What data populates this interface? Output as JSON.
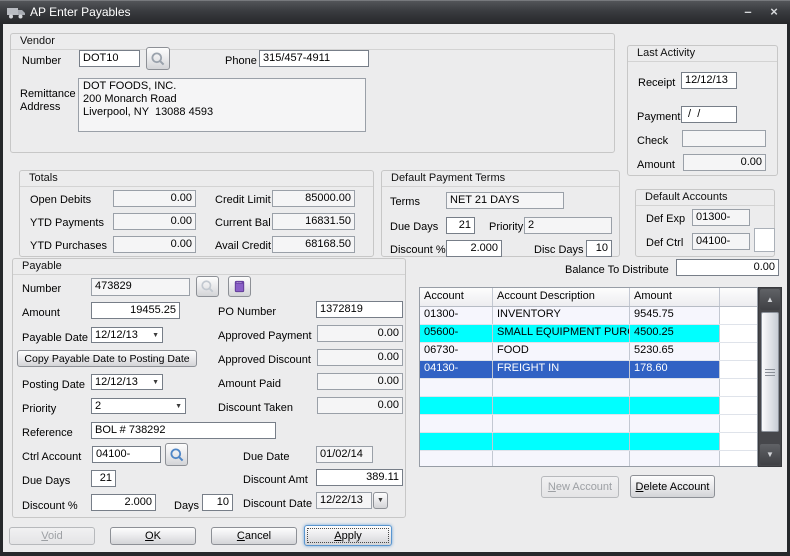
{
  "window": {
    "title": "AP Enter Payables"
  },
  "glyphs": {
    "minimize": "–",
    "close": "×",
    "arrow_down": "▼",
    "arrow_up": "▲"
  },
  "vendor": {
    "caption": "Vendor",
    "number_label": "Number",
    "number": "DOT10",
    "phone_label": "Phone",
    "phone": "315/457-4911",
    "remittance_label": "Remittance\nAddress",
    "address": "DOT FOODS, INC.\n200 Monarch Road\nLiverpool, NY  13088 4593"
  },
  "last_activity": {
    "caption": "Last Activity",
    "receipt_label": "Receipt",
    "receipt": "12/12/13",
    "payment_label": "Payment",
    "payment": " /  /",
    "check_label": "Check",
    "check": "",
    "amount_label": "Amount",
    "amount": "0.00"
  },
  "totals": {
    "caption": "Totals",
    "open_debits_label": "Open Debits",
    "open_debits": "0.00",
    "ytd_payments_label": "YTD Payments",
    "ytd_payments": "0.00",
    "ytd_purchases_label": "YTD Purchases",
    "ytd_purchases": "0.00",
    "credit_limit_label": "Credit Limit",
    "credit_limit": "85000.00",
    "current_bal_label": "Current Bal",
    "current_bal": "16831.50",
    "avail_credit_label": "Avail Credit",
    "avail_credit": "68168.50"
  },
  "terms": {
    "caption": "Default Payment Terms",
    "terms_label": "Terms",
    "terms": "NET 21 DAYS",
    "due_days_label": "Due Days",
    "due_days": "21",
    "priority_label": "Priority",
    "priority": "2",
    "discount_label": "Discount %",
    "discount": "2.000",
    "disc_days_label": "Disc Days",
    "disc_days": "10"
  },
  "default_accounts": {
    "caption": "Default Accounts",
    "def_exp_label": "Def Exp",
    "def_exp": "01300-",
    "def_ctrl_label": "Def Ctrl",
    "def_ctrl": "04100-"
  },
  "payable": {
    "caption": "Payable",
    "number_label": "Number",
    "number": "473829",
    "amount_label": "Amount",
    "amount": "19455.25",
    "payable_date_label": "Payable Date",
    "payable_date": "12/12/13",
    "copy_button": "Copy Payable Date to Posting Date",
    "posting_date_label": "Posting Date",
    "posting_date": "12/12/13",
    "priority_label": "Priority",
    "priority": "2",
    "reference_label": "Reference",
    "reference": "BOL # 738292",
    "ctrl_account_label": "Ctrl Account",
    "ctrl_account": "04100-",
    "due_days_label": "Due Days",
    "due_days": "21",
    "discount_label": "Discount %",
    "discount": "2.000",
    "days_label": "Days",
    "days": "10",
    "po_label": "PO Number",
    "po": "1372819",
    "approved_payment_label": "Approved Payment",
    "approved_payment": "0.00",
    "approved_discount_label": "Approved Discount",
    "approved_discount": "0.00",
    "amount_paid_label": "Amount Paid",
    "amount_paid": "0.00",
    "discount_taken_label": "Discount Taken",
    "discount_taken": "0.00",
    "due_date_label": "Due Date",
    "due_date": "01/02/14",
    "discount_amt_label": "Discount Amt",
    "discount_amt": "389.11",
    "discount_date_label": "Discount Date",
    "discount_date": "12/22/13"
  },
  "distribution": {
    "balance_label": "Balance To Distribute",
    "balance": "0.00",
    "columns": [
      "Account",
      "Account Description",
      "Amount"
    ],
    "rows": [
      {
        "account": "01300-",
        "description": "INVENTORY",
        "amount": "9545.75",
        "selected": false
      },
      {
        "account": "05600-",
        "description": "SMALL EQUIPMENT PURCHA",
        "amount": "4500.25",
        "selected": false
      },
      {
        "account": "06730-",
        "description": "FOOD",
        "amount": "5230.65",
        "selected": false
      },
      {
        "account": "04130-",
        "description": "FREIGHT IN",
        "amount": "178.60",
        "selected": true
      },
      {
        "account": "",
        "description": "",
        "amount": "",
        "selected": false
      },
      {
        "account": "",
        "description": "",
        "amount": "",
        "selected": false
      },
      {
        "account": "",
        "description": "",
        "amount": "",
        "selected": false
      },
      {
        "account": "",
        "description": "",
        "amount": "",
        "selected": false
      },
      {
        "account": "",
        "description": "",
        "amount": "",
        "selected": false
      }
    ],
    "new_button": {
      "accel": "N",
      "rest": "ew Account"
    },
    "delete_button": {
      "accel": "D",
      "rest": "elete Account"
    }
  },
  "footer": {
    "void": {
      "accel": "V",
      "rest": "oid"
    },
    "ok": {
      "accel": "O",
      "rest": "K"
    },
    "cancel": {
      "accel": "C",
      "rest": "ancel"
    },
    "apply": {
      "accel": "A",
      "rest": "pply"
    }
  },
  "colors": {
    "row_alt": "#00ffff",
    "row_selected": "#3162c4",
    "titlebar": "#3a3c40"
  }
}
